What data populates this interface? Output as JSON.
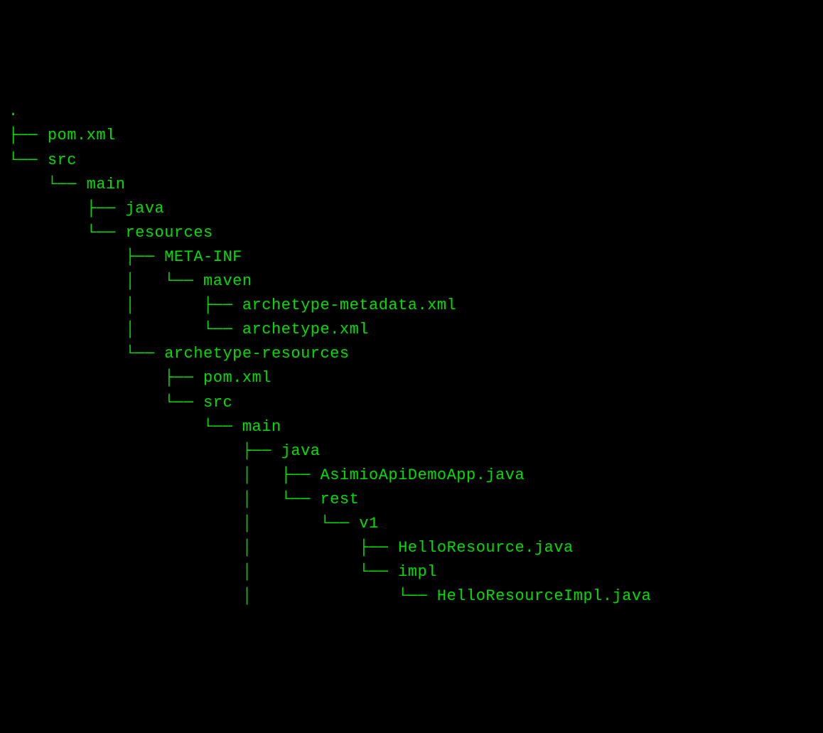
{
  "tree": {
    "root": ".",
    "lines": [
      {
        "prefix": "├── ",
        "name": "pom.xml"
      },
      {
        "prefix": "└── ",
        "name": "src"
      },
      {
        "prefix": "    └── ",
        "name": "main"
      },
      {
        "prefix": "        ├── ",
        "name": "java"
      },
      {
        "prefix": "        └── ",
        "name": "resources"
      },
      {
        "prefix": "            ├── ",
        "name": "META-INF"
      },
      {
        "prefix": "            │   └── ",
        "name": "maven"
      },
      {
        "prefix": "            │       ├── ",
        "name": "archetype-metadata.xml"
      },
      {
        "prefix": "            │       └── ",
        "name": "archetype.xml"
      },
      {
        "prefix": "            └── ",
        "name": "archetype-resources"
      },
      {
        "prefix": "                ├── ",
        "name": "pom.xml"
      },
      {
        "prefix": "                └── ",
        "name": "src"
      },
      {
        "prefix": "                    └── ",
        "name": "main"
      },
      {
        "prefix": "                        ├── ",
        "name": "java"
      },
      {
        "prefix": "                        │   ├── ",
        "name": "AsimioApiDemoApp.java"
      },
      {
        "prefix": "                        │   └── ",
        "name": "rest"
      },
      {
        "prefix": "                        │       └── ",
        "name": "v1"
      },
      {
        "prefix": "                        │           ├── ",
        "name": "HelloResource.java"
      },
      {
        "prefix": "                        │           └── ",
        "name": "impl"
      },
      {
        "prefix": "                        │               └── ",
        "name": "HelloResourceImpl.java"
      }
    ]
  }
}
